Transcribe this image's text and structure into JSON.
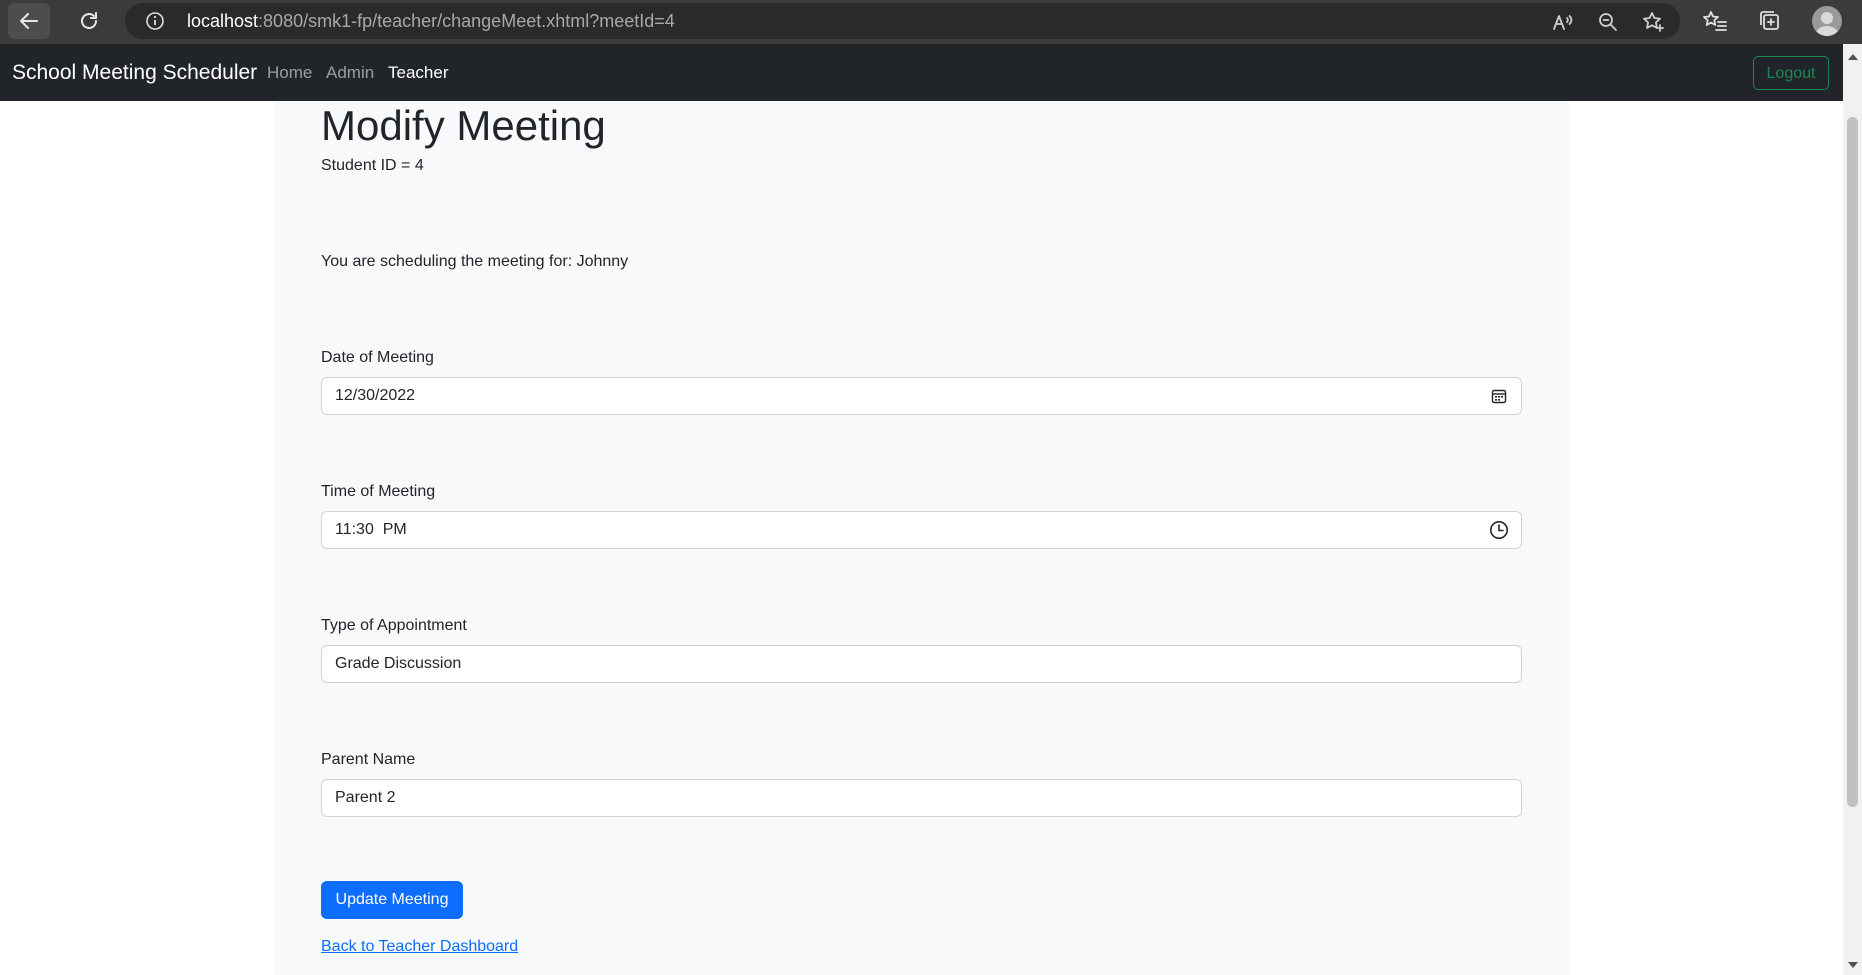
{
  "browser": {
    "url_host": "localhost",
    "url_rest": ":8080/smk1-fp/teacher/changeMeet.xhtml?meetId=4"
  },
  "navbar": {
    "brand": "School Meeting Scheduler",
    "links": [
      {
        "label": "Home",
        "active": false
      },
      {
        "label": "Admin",
        "active": false
      },
      {
        "label": "Teacher",
        "active": true
      }
    ],
    "logout_label": "Logout"
  },
  "main": {
    "title": "Modify Meeting",
    "student_id_text": "Student ID = 4",
    "scheduling_text": "You are scheduling the meeting for: Johnny",
    "date": {
      "label": "Date of Meeting",
      "value": "12/30/2022"
    },
    "time": {
      "label": "Time of Meeting",
      "value": "11:30  PM"
    },
    "type": {
      "label": "Type of Appointment",
      "value": "Grade Discussion"
    },
    "parent": {
      "label": "Parent Name",
      "value": "Parent 2"
    },
    "update_button": "Update Meeting",
    "back_link": "Back to Teacher Dashboard"
  },
  "colors": {
    "navbar_bg": "#212529",
    "primary": "#0d6efd",
    "success": "#198754",
    "container_bg": "#f8f9fa"
  }
}
